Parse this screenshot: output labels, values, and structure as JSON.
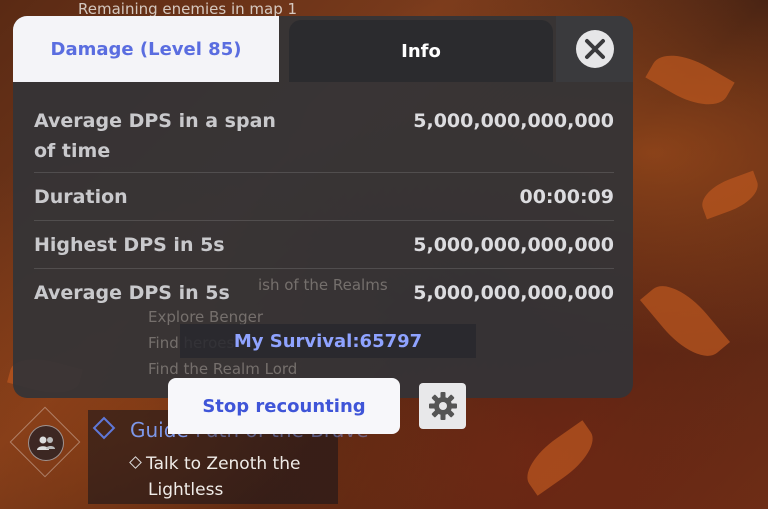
{
  "hud": {
    "remaining_enemies": "Remaining enemies in map 1"
  },
  "tabs": {
    "damage": "Damage (Level 85)",
    "info": "Info"
  },
  "stats": [
    {
      "label": "Average DPS in a span of time",
      "value": "5,000,000,000,000"
    },
    {
      "label": "Duration",
      "value": "00:00:09"
    },
    {
      "label": "Highest DPS in 5s",
      "value": "5,000,000,000,000"
    },
    {
      "label": "Average DPS in 5s",
      "value": "5,000,000,000,000"
    }
  ],
  "background_text": {
    "line1": "ish of the Realms",
    "line2": "Explore Benger",
    "line3": "Find heroes",
    "line4": "Find the Realm Lord"
  },
  "survival": "My Survival:65797",
  "buttons": {
    "stop": "Stop recounting"
  },
  "quest": {
    "title_visible": "Guide",
    "title_faded": " Path of the Brave",
    "step_line1": "Talk to Zenoth the",
    "step_line2": "Lightless"
  },
  "icons": {
    "close": "close-icon",
    "gear": "gear-icon",
    "social": "friends-icon"
  },
  "colors": {
    "accent": "#5a6de0",
    "survival": "#8fa3ff",
    "quest": "#7d97e8"
  }
}
